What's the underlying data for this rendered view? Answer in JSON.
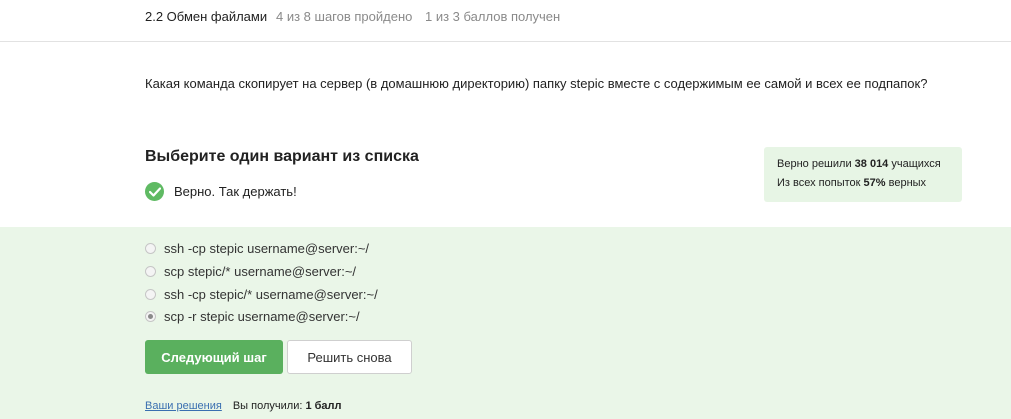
{
  "header": {
    "lesson_title": "2.2 Обмен файлами",
    "steps_progress": "4 из 8 шагов пройдено",
    "score_progress": "1 из 3 баллов  получен"
  },
  "question": {
    "text": "Какая команда скопирует на сервер (в домашнюю директорию) папку stepic вместе с содержимым ее самой и всех ее подпапок?"
  },
  "quiz": {
    "instruction": "Выберите один вариант из списка",
    "feedback": "Верно. Так держать!",
    "options": [
      {
        "label": "ssh -cp stepic username@server:~/",
        "selected": false
      },
      {
        "label": "scp stepic/* username@server:~/",
        "selected": false
      },
      {
        "label": "ssh -cp stepic/* username@server:~/",
        "selected": false
      },
      {
        "label": "scp -r stepic username@server:~/",
        "selected": true
      }
    ],
    "next_button": "Следующий шаг",
    "retry_button": "Решить снова"
  },
  "stats": {
    "solved_prefix": "Верно решили",
    "solved_count": "38 014",
    "solved_suffix": "учащихся",
    "attempts_prefix": "Из всех попыток",
    "attempts_percent": "57%",
    "attempts_suffix": "верных"
  },
  "footer": {
    "solutions_link": "Ваши решения",
    "received_prefix": "Вы получили:",
    "received_value": "1 балл"
  },
  "colors": {
    "accent_green": "#5ab05e",
    "answer_bg": "#eaf6e8",
    "stats_bg": "#e7f5e5"
  }
}
